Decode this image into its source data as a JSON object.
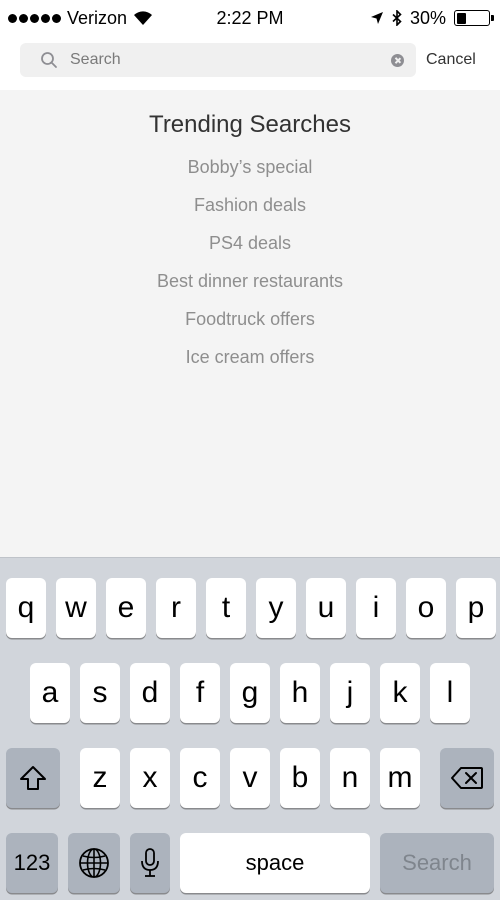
{
  "status_bar": {
    "carrier": "Verizon",
    "time": "2:22 PM",
    "battery_percent": "30%",
    "battery_level": 0.3
  },
  "search": {
    "placeholder": "Search",
    "value": "",
    "cancel_label": "Cancel"
  },
  "trending": {
    "title": "Trending Searches",
    "items": [
      "Bobby’s special",
      "Fashion deals",
      "PS4 deals",
      "Best dinner restaurants",
      "Foodtruck offers",
      "Ice cream offers"
    ]
  },
  "keyboard": {
    "row1": [
      "q",
      "w",
      "e",
      "r",
      "t",
      "y",
      "u",
      "i",
      "o",
      "p"
    ],
    "row2": [
      "a",
      "s",
      "d",
      "f",
      "g",
      "h",
      "j",
      "k",
      "l"
    ],
    "row3": [
      "z",
      "x",
      "c",
      "v",
      "b",
      "n",
      "m"
    ],
    "numbers_label": "123",
    "space_label": "space",
    "search_label": "Search",
    "icons": {
      "shift": "shift-icon",
      "backspace": "backspace-icon",
      "globe": "globe-icon",
      "mic": "microphone-icon"
    }
  }
}
